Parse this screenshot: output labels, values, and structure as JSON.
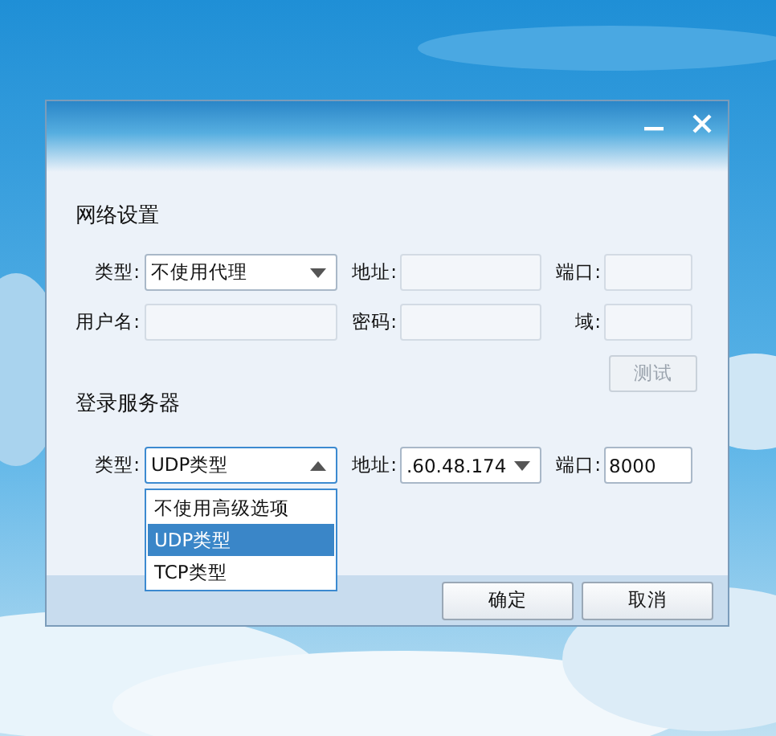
{
  "sections": [
    {
      "title": "网络设置",
      "rows": [
        [
          {
            "label": "类型:",
            "kind": "combo",
            "value": "不使用代理",
            "expanded": false
          },
          {
            "label": "地址:",
            "kind": "text",
            "disabled": true
          },
          {
            "label": "端口:",
            "kind": "text",
            "disabled": true
          }
        ],
        [
          {
            "label": "用户名:",
            "kind": "text",
            "disabled": true
          },
          {
            "label": "密码:",
            "kind": "text",
            "disabled": true
          },
          {
            "label": "域:",
            "kind": "text",
            "disabled": true
          }
        ]
      ],
      "button": {
        "label": "测试",
        "disabled": true
      }
    },
    {
      "title": "登录服务器",
      "rows": [
        [
          {
            "label": "类型:",
            "kind": "combo",
            "value": "UDP类型",
            "expanded": true,
            "options": [
              {
                "label": "不使用高级选项",
                "selected": false
              },
              {
                "label": "UDP类型",
                "selected": true
              },
              {
                "label": "TCP类型",
                "selected": false
              }
            ]
          },
          {
            "label": "地址:",
            "kind": "combo",
            "value": ".60.48.174",
            "expanded": false
          },
          {
            "label": "端口:",
            "kind": "text",
            "value": "8000",
            "disabled": false
          }
        ]
      ]
    }
  ],
  "buttons": [
    "确定",
    "取消"
  ]
}
